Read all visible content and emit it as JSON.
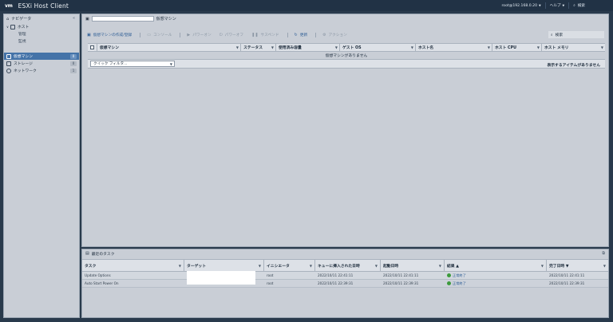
{
  "topbar": {
    "logo": "vm",
    "title": "ESXi Host Client",
    "user": "root@192.168.0.20",
    "help": "ヘルプ",
    "search": "検索"
  },
  "navigator": {
    "title": "ナビゲータ",
    "host": "ホスト",
    "manage": "管理",
    "monitor": "監視",
    "items": [
      {
        "label": "仮想マシン",
        "badge": "0",
        "icon": "vm-icon"
      },
      {
        "label": "ストレージ",
        "badge": "0",
        "icon": "storage-icon"
      },
      {
        "label": "ネットワーク",
        "badge": "1",
        "icon": "network-icon"
      }
    ]
  },
  "main": {
    "breadcrumb_search_value": "",
    "title": "仮想マシン",
    "toolbar": {
      "create": "仮想マシンの作成/登録",
      "console": "コンソール",
      "power_on": "パワーオン",
      "power_off": "パワーオフ",
      "suspend": "サスペンド",
      "refresh": "更新",
      "actions": "アクション",
      "search_placeholder": "検索"
    },
    "columns": [
      "仮想マシン",
      "ステータス",
      "使用済み容量",
      "ゲスト OS",
      "ホスト名",
      "ホスト CPU",
      "ホスト メモリ"
    ],
    "empty_message": "仮想マシンがありません",
    "quick_filter": "クイック フィルタ...",
    "no_items": "表示するアイテムがありません"
  },
  "tasks": {
    "title": "最近のタスク",
    "columns": [
      "タスク",
      "ターゲット",
      "イニシエータ",
      "キューに挿入された日時",
      "起動日時",
      "結果 ▲",
      "完了日時 ▼"
    ],
    "rows": [
      {
        "task": "Update Options",
        "target": "",
        "initiator": "root",
        "queued": "2022/10/11 22:41:11",
        "started": "2022/10/11 22:41:11",
        "result": "正常終了",
        "completed": "2022/10/11 22:41:11"
      },
      {
        "task": "Auto Start Power On",
        "target": "",
        "initiator": "root",
        "queued": "2022/10/11 22:39:31",
        "started": "2022/10/11 22:39:31",
        "result": "正常終了",
        "completed": "2022/10/11 22:39:31"
      }
    ]
  }
}
